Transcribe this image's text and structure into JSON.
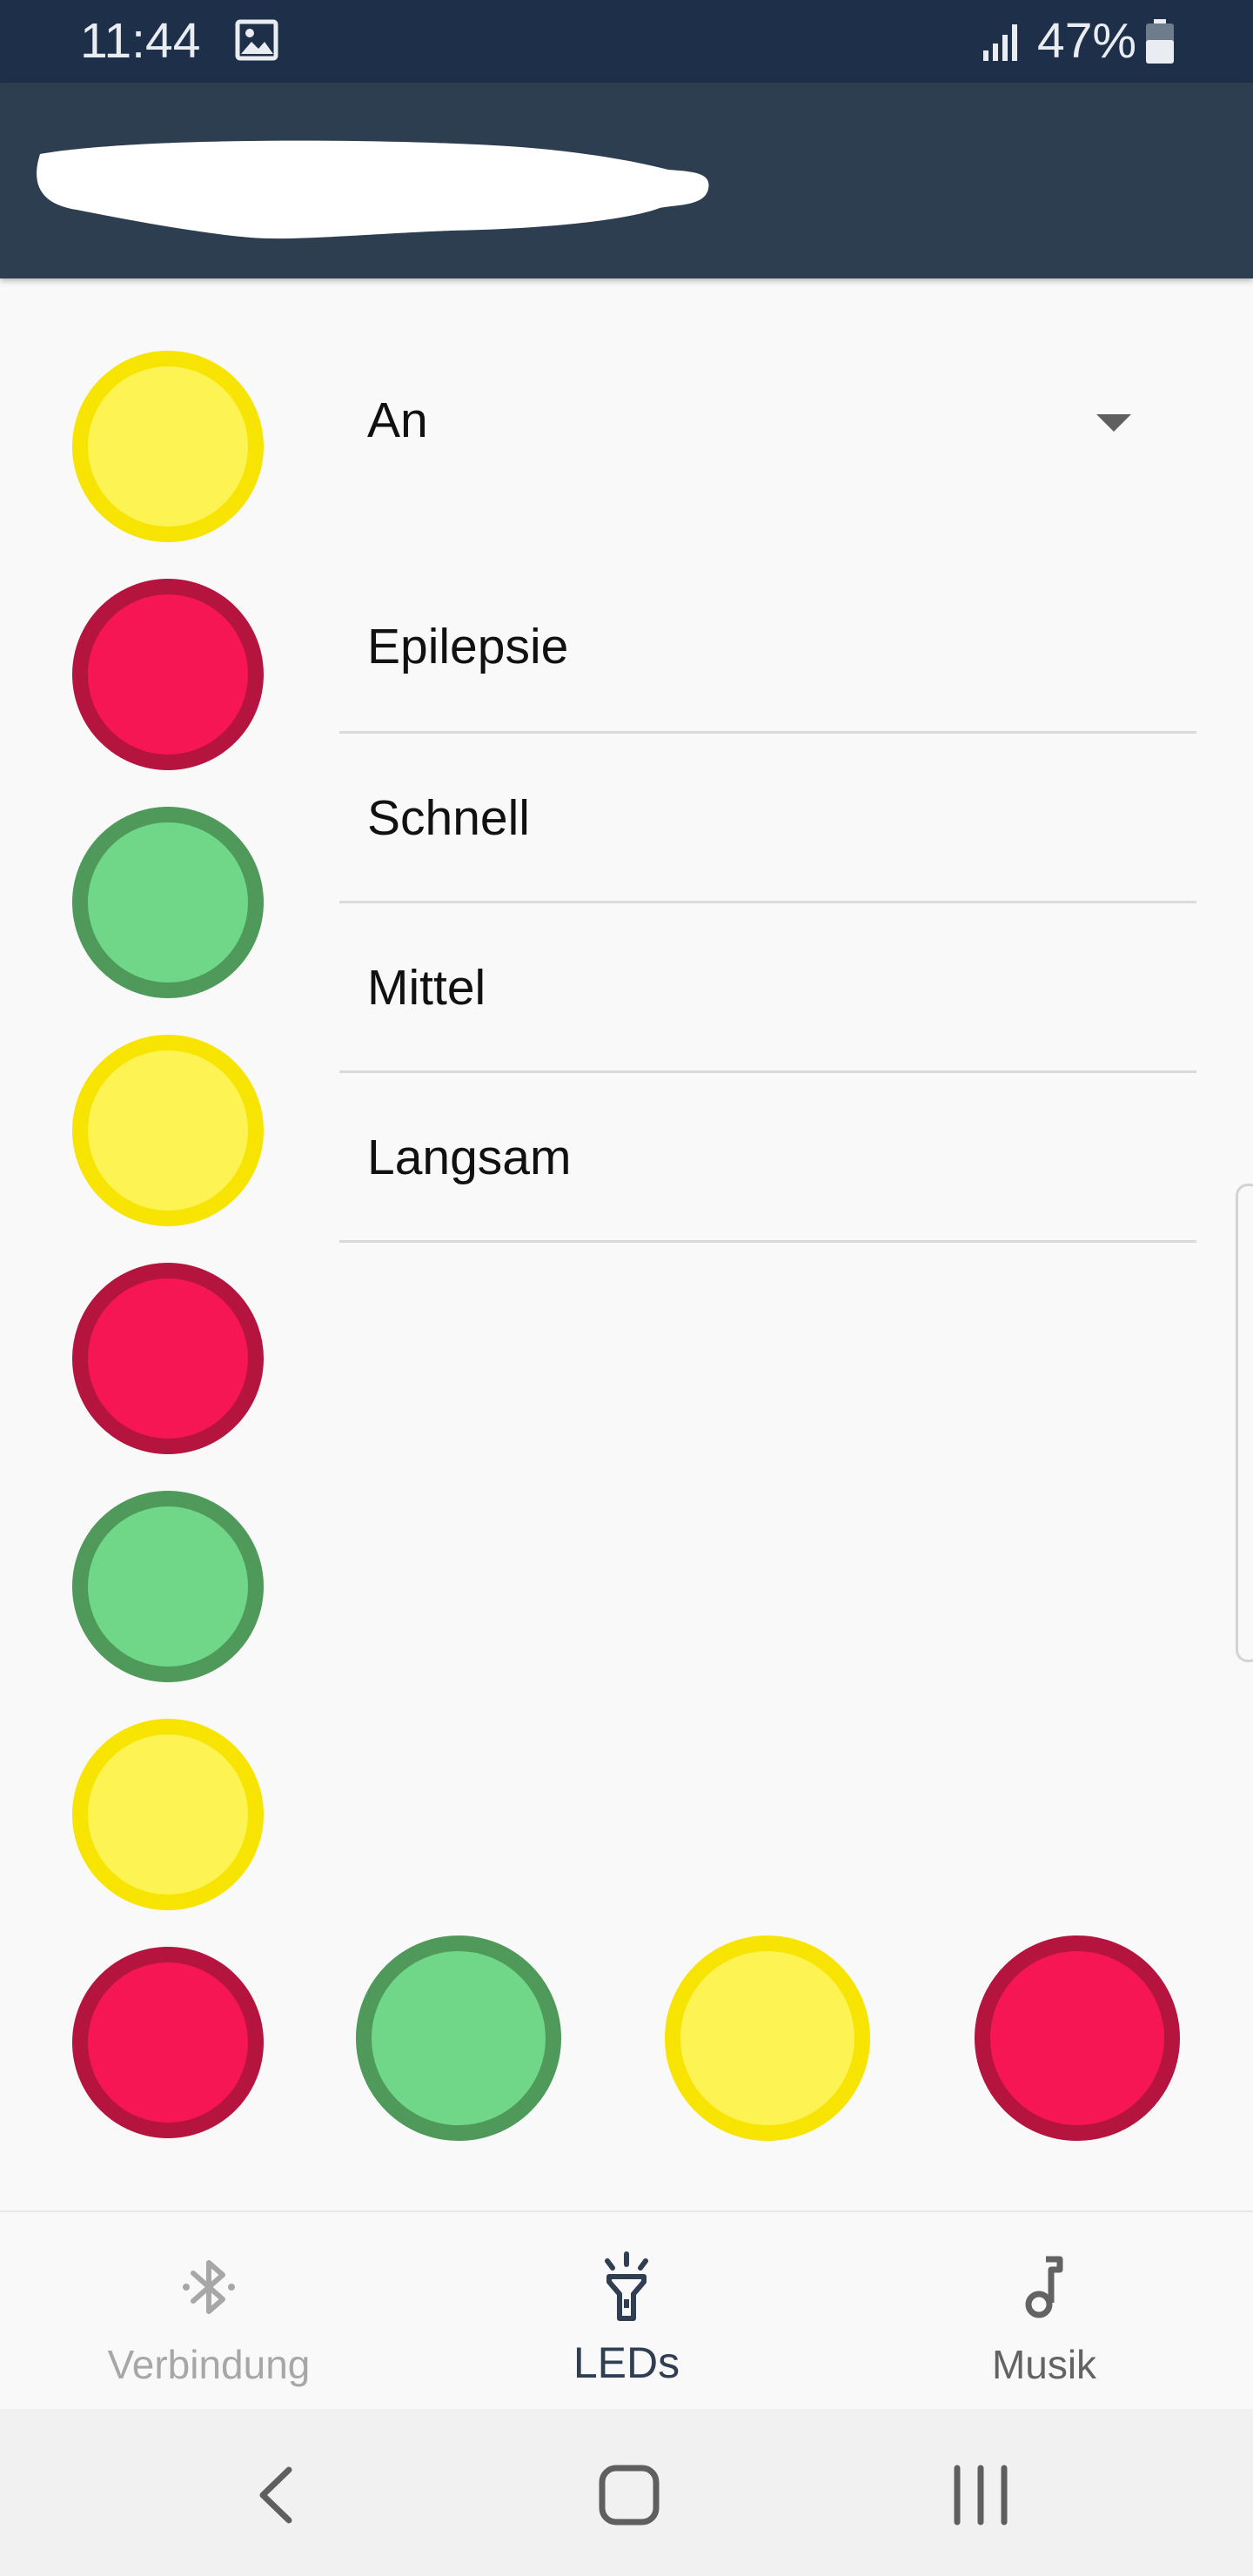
{
  "status_bar": {
    "time": "11:44",
    "battery": "47%",
    "icons": [
      "image-icon",
      "signal-icon",
      "battery-icon"
    ]
  },
  "app_bar": {
    "title_redacted": true
  },
  "colors": {
    "yellow_fill": "#fdf454",
    "yellow_ring": "#f7e402",
    "red_fill": "#f61653",
    "red_ring": "#b5143f",
    "green_fill": "#6fd787",
    "green_ring": "#4f995b",
    "app_bar": "#2e3e51",
    "status_bar": "#1e3049"
  },
  "leds": {
    "left_column": [
      "yellow",
      "red",
      "green",
      "yellow",
      "red",
      "green",
      "yellow",
      "red"
    ],
    "bottom_row": [
      "green",
      "yellow",
      "red"
    ]
  },
  "mode_dropdown": {
    "selected": "An",
    "options": [
      "Epilepsie",
      "Schnell",
      "Mittel",
      "Langsam"
    ]
  },
  "bottom_nav": {
    "items": [
      {
        "label": "Verbindung",
        "icon": "bluetooth-icon",
        "active": false
      },
      {
        "label": "LEDs",
        "icon": "flashlight-icon",
        "active": true
      },
      {
        "label": "Musik",
        "icon": "music-note-icon",
        "active": false
      }
    ]
  },
  "system_nav": {
    "buttons": [
      "back",
      "home",
      "recents"
    ]
  }
}
